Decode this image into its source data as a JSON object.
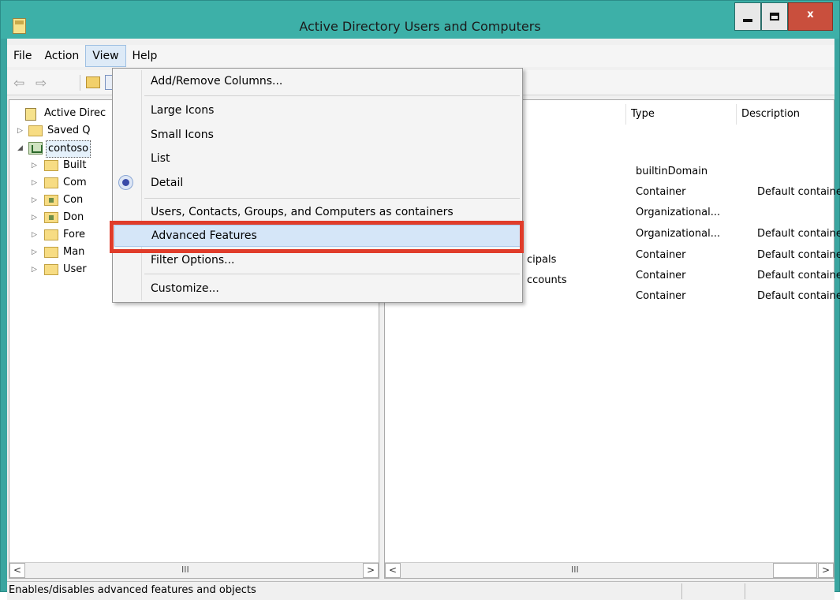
{
  "window": {
    "title": "Active Directory Users and Computers",
    "close_glyph": "x",
    "colors": {
      "frame": "#3db0a8",
      "close": "#c94f3d",
      "menu_highlight": "#d5e6f8",
      "callout": "#e03c2a"
    }
  },
  "menubar": {
    "items": [
      "File",
      "Action",
      "View",
      "Help"
    ],
    "active": "View"
  },
  "tree": {
    "root": "Active Direc",
    "items": [
      {
        "label": "Saved Q",
        "icon": "folder-icon"
      },
      {
        "label": "contoso",
        "icon": "domain-icon",
        "selected": true
      },
      {
        "label": "Built",
        "icon": "folder-icon"
      },
      {
        "label": "Com",
        "icon": "folder-icon"
      },
      {
        "label": "Con",
        "icon": "ou-folder-icon"
      },
      {
        "label": "Don",
        "icon": "ou-folder-icon"
      },
      {
        "label": "Fore",
        "icon": "folder-icon"
      },
      {
        "label": "Man",
        "icon": "folder-icon"
      },
      {
        "label": "User",
        "icon": "folder-icon"
      }
    ]
  },
  "details": {
    "columns": [
      "Type",
      "Description"
    ],
    "rows": [
      {
        "name": "",
        "type": "builtinDomain",
        "description": ""
      },
      {
        "name": "",
        "type": "Container",
        "description": "Default containe"
      },
      {
        "name": "",
        "type": "Organizational...",
        "description": ""
      },
      {
        "name": "",
        "type": "Organizational...",
        "description": "Default containe"
      },
      {
        "name": "cipals",
        "type": "Container",
        "description": "Default containe"
      },
      {
        "name": "ccounts",
        "type": "Container",
        "description": "Default containe"
      },
      {
        "name": "",
        "type": "Container",
        "description": "Default containe"
      }
    ]
  },
  "view_menu": {
    "items": [
      "Add/Remove Columns...",
      "Large Icons",
      "Small Icons",
      "List",
      "Detail",
      "Users, Contacts, Groups, and Computers as containers",
      "Advanced Features",
      "Filter Options...",
      "Customize..."
    ],
    "checked": "Detail",
    "highlighted": "Advanced Features"
  },
  "scrollbar": {
    "left_arrow": "<",
    "right_arrow": ">",
    "thumb": "III"
  },
  "status": {
    "text": "Enables/disables advanced features and objects"
  }
}
